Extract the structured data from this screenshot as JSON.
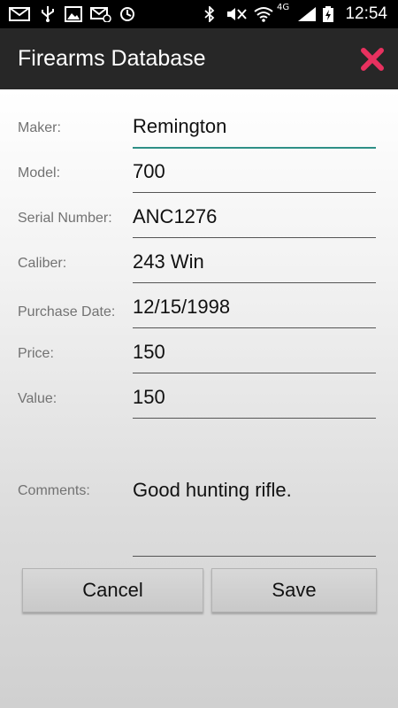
{
  "status_bar": {
    "time": "12:54",
    "network_label": "4G",
    "icons": [
      "mail-icon",
      "usb-icon",
      "image-icon",
      "email-sync-icon",
      "vpn-icon",
      "bluetooth-icon",
      "mute-icon",
      "wifi-icon",
      "4g-icon",
      "signal-icon",
      "battery-charging-icon"
    ]
  },
  "action_bar": {
    "title": "Firearms Database",
    "close_icon": "close-icon",
    "close_color": "#e8315f"
  },
  "form": {
    "fields": [
      {
        "label": "Maker:",
        "value": "Remington"
      },
      {
        "label": "Model:",
        "value": "700"
      },
      {
        "label": "Serial Number:",
        "value": "ANC1276"
      },
      {
        "label": "Caliber:",
        "value": "243 Win"
      },
      {
        "label": "Purchase Date:",
        "value": "12/15/1998"
      },
      {
        "label": "Price:",
        "value": "150"
      },
      {
        "label": "Value:",
        "value": "150"
      }
    ],
    "comments": {
      "label": "Comments:",
      "value": "Good hunting rifle."
    }
  },
  "buttons": {
    "cancel_label": "Cancel",
    "save_label": "Save"
  },
  "colors": {
    "focus_underline": "#2e8f86",
    "action_bar": "#272727"
  }
}
